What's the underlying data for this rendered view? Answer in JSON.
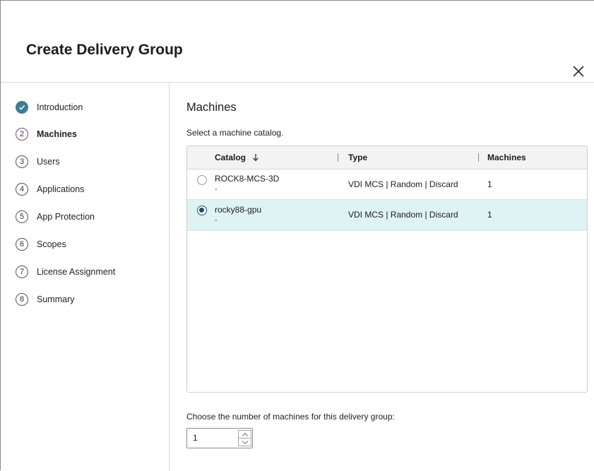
{
  "dialog": {
    "title": "Create Delivery Group",
    "close_icon": "close-icon"
  },
  "steps": [
    {
      "number": "",
      "label": "Introduction",
      "state": "done"
    },
    {
      "number": "2",
      "label": "Machines",
      "state": "current"
    },
    {
      "number": "3",
      "label": "Users",
      "state": "pending"
    },
    {
      "number": "4",
      "label": "Applications",
      "state": "pending"
    },
    {
      "number": "5",
      "label": "App Protection",
      "state": "pending"
    },
    {
      "number": "6",
      "label": "Scopes",
      "state": "pending"
    },
    {
      "number": "7",
      "label": "License Assignment",
      "state": "pending"
    },
    {
      "number": "8",
      "label": "Summary",
      "state": "pending"
    }
  ],
  "main": {
    "section_title": "Machines",
    "instruction": "Select a machine catalog.",
    "table": {
      "columns": [
        "Catalog",
        "Type",
        "Machines"
      ],
      "sort_icon": "arrow-down-icon",
      "rows": [
        {
          "catalog": "ROCK8-MCS-3D",
          "description": "-",
          "type": "VDI MCS | Random | Discard",
          "machines": "1",
          "selected": false
        },
        {
          "catalog": "rocky88-gpu",
          "description": "-",
          "type": "VDI MCS | Random | Discard",
          "machines": "1",
          "selected": true
        }
      ]
    },
    "count_label": "Choose the number of machines for this delivery group:",
    "count_value": "1"
  },
  "colors": {
    "accent": "#3e7c95",
    "selected_row": "#dff3f3",
    "current_step_ring": "#6a4c93",
    "radio_fill": "#1f4f68"
  }
}
